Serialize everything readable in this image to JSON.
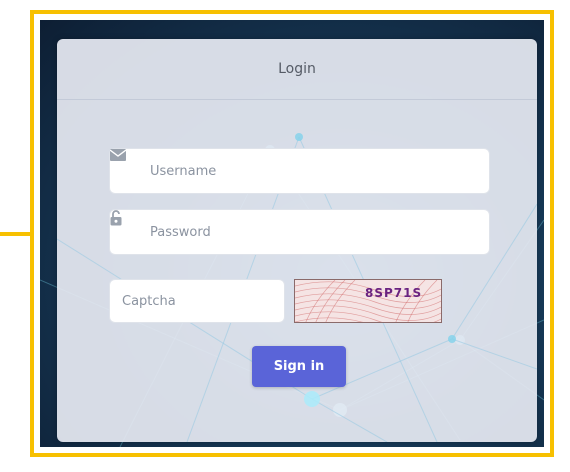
{
  "card": {
    "title": "Login"
  },
  "form": {
    "username_placeholder": "Username",
    "password_placeholder": "Password",
    "captcha_placeholder": "Captcha",
    "captcha_text": "8SP71S",
    "submit_label": "Sign in"
  },
  "icons": {
    "username": "envelope-icon",
    "password": "lock-icon"
  },
  "colors": {
    "frame": "#f7c000",
    "button": "#5a64d8",
    "captcha_text": "#6a2380",
    "background": "#0d1e33"
  }
}
